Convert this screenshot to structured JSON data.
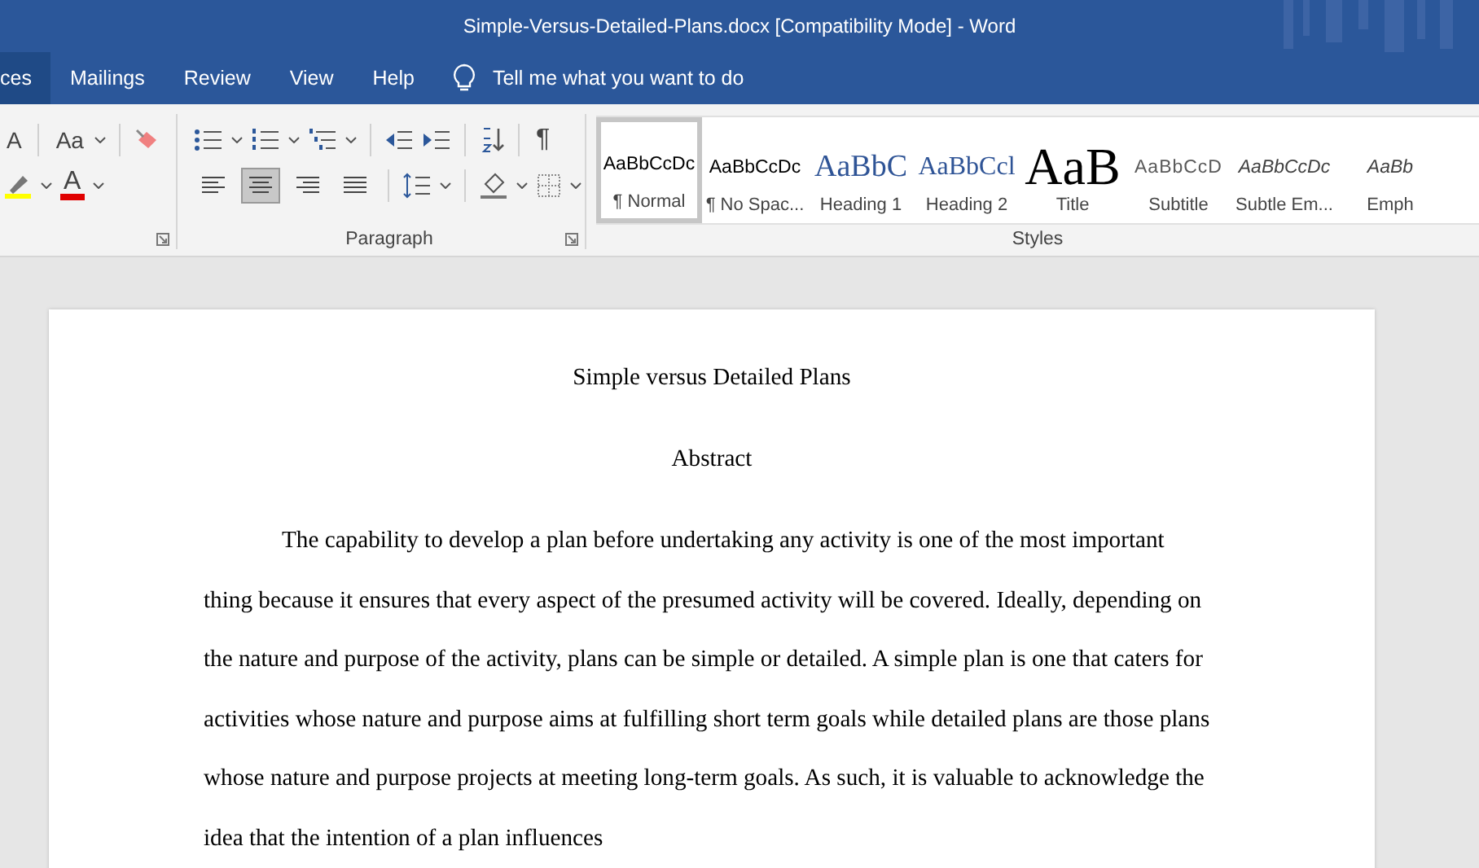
{
  "window": {
    "title": "Simple-Versus-Detailed-Plans.docx [Compatibility Mode]  -  Word"
  },
  "tabs": [
    {
      "label": "ces",
      "selected": true
    },
    {
      "label": "Mailings",
      "selected": false
    },
    {
      "label": "Review",
      "selected": false
    },
    {
      "label": "View",
      "selected": false
    },
    {
      "label": "Help",
      "selected": false
    }
  ],
  "tell_me": {
    "placeholder": "Tell me what you want to do"
  },
  "font_group": {
    "grow_label": "A",
    "case_label": "Aa",
    "color_label": "A"
  },
  "paragraph_group": {
    "label": "Paragraph",
    "pilcrow": "¶",
    "alignments": [
      {
        "kind": "left",
        "selected": false
      },
      {
        "kind": "center",
        "selected": true
      },
      {
        "kind": "right",
        "selected": false
      },
      {
        "kind": "justify",
        "selected": false
      }
    ]
  },
  "styles_group": {
    "label": "Styles",
    "items": [
      {
        "kind": "normal",
        "preview": "AaBbCcDc",
        "name": "¶ Normal",
        "selected": true
      },
      {
        "kind": "normal",
        "preview": "AaBbCcDc",
        "name": "¶ No Spac...",
        "selected": false
      },
      {
        "kind": "heading1",
        "preview": "AaBbC",
        "name": "Heading 1",
        "selected": false
      },
      {
        "kind": "heading2",
        "preview": "AaBbCcl",
        "name": "Heading 2",
        "selected": false
      },
      {
        "kind": "title",
        "preview": "AaB",
        "name": "Title",
        "selected": false
      },
      {
        "kind": "subtitle",
        "preview": "AaBbCcD",
        "name": "Subtitle",
        "selected": false
      },
      {
        "kind": "emphasis",
        "preview": "AaBbCcDc",
        "name": "Subtle Em...",
        "selected": false
      },
      {
        "kind": "emphasis",
        "preview": "AaBb",
        "name": "Emph",
        "selected": false
      }
    ]
  },
  "document": {
    "title": "Simple versus Detailed Plans",
    "heading": "Abstract",
    "paragraph": "The capability to develop a plan before undertaking any activity is one of the most important thing because it ensures that every aspect of the presumed activity will be covered. Ideally, depending on the nature and purpose of the activity, plans can be simple or detailed. A simple plan is one that caters for activities whose nature and purpose aims at fulfilling short term goals while detailed plans are those plans whose nature and purpose projects at meeting long-term goals. As such, it is valuable to acknowledge the idea that the intention of a plan influences"
  }
}
